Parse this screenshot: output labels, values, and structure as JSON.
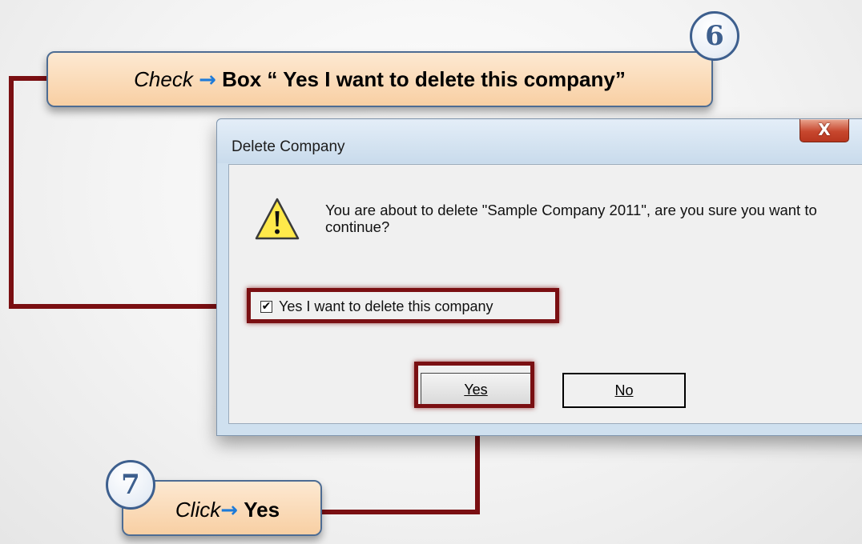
{
  "dialog": {
    "title": "Delete Company",
    "close_symbol": "X",
    "message": "You are about to delete \"Sample Company 2011\", are you sure you want to continue?",
    "checkbox_label": "Yes I want to delete this company",
    "checkbox_checked": true,
    "checkbox_mark": "✔",
    "yes_button": "Yes",
    "no_button": "No"
  },
  "callouts": {
    "step6": {
      "number": "6",
      "verb": "Check",
      "arrow": "→",
      "text": "Box “ Yes I want to delete this company”"
    },
    "step7": {
      "number": "7",
      "verb": "Click",
      "arrow": "→",
      "text": "Yes"
    }
  },
  "icons": {
    "warning": "warning-icon",
    "close": "close-icon"
  },
  "colors": {
    "highlight": "#7a0f12",
    "connector": "#8b1010",
    "callout_fill": "#f8cfa3",
    "callout_border": "#4d6c93",
    "arrow_blue": "#1e7bd8"
  }
}
